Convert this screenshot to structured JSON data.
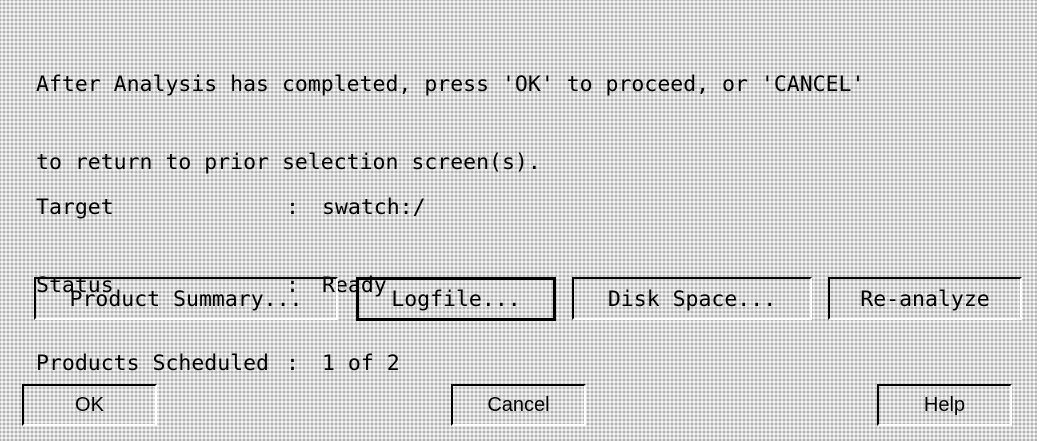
{
  "message": {
    "line1": "After Analysis has completed, press 'OK' to proceed, or 'CANCEL'",
    "line2": "to return to prior selection screen(s)."
  },
  "info": [
    {
      "label": "Target",
      "colon": ":",
      "value": "swatch:/"
    },
    {
      "label": "Status",
      "colon": ":",
      "value": "Ready"
    },
    {
      "label": "Products Scheduled",
      "colon": ":",
      "value": "1 of 2"
    }
  ],
  "action_buttons": {
    "product_summary": "Product Summary...",
    "logfile": "Logfile...",
    "disk_space": "Disk Space...",
    "reanalyze": "Re-analyze"
  },
  "footer_buttons": {
    "ok": "OK",
    "cancel": "Cancel",
    "help": "Help"
  },
  "colors": {
    "background": "#d9d9d9",
    "text": "#000000",
    "bevel_shadow": "#000000",
    "bevel_highlight": "#ffffff"
  }
}
